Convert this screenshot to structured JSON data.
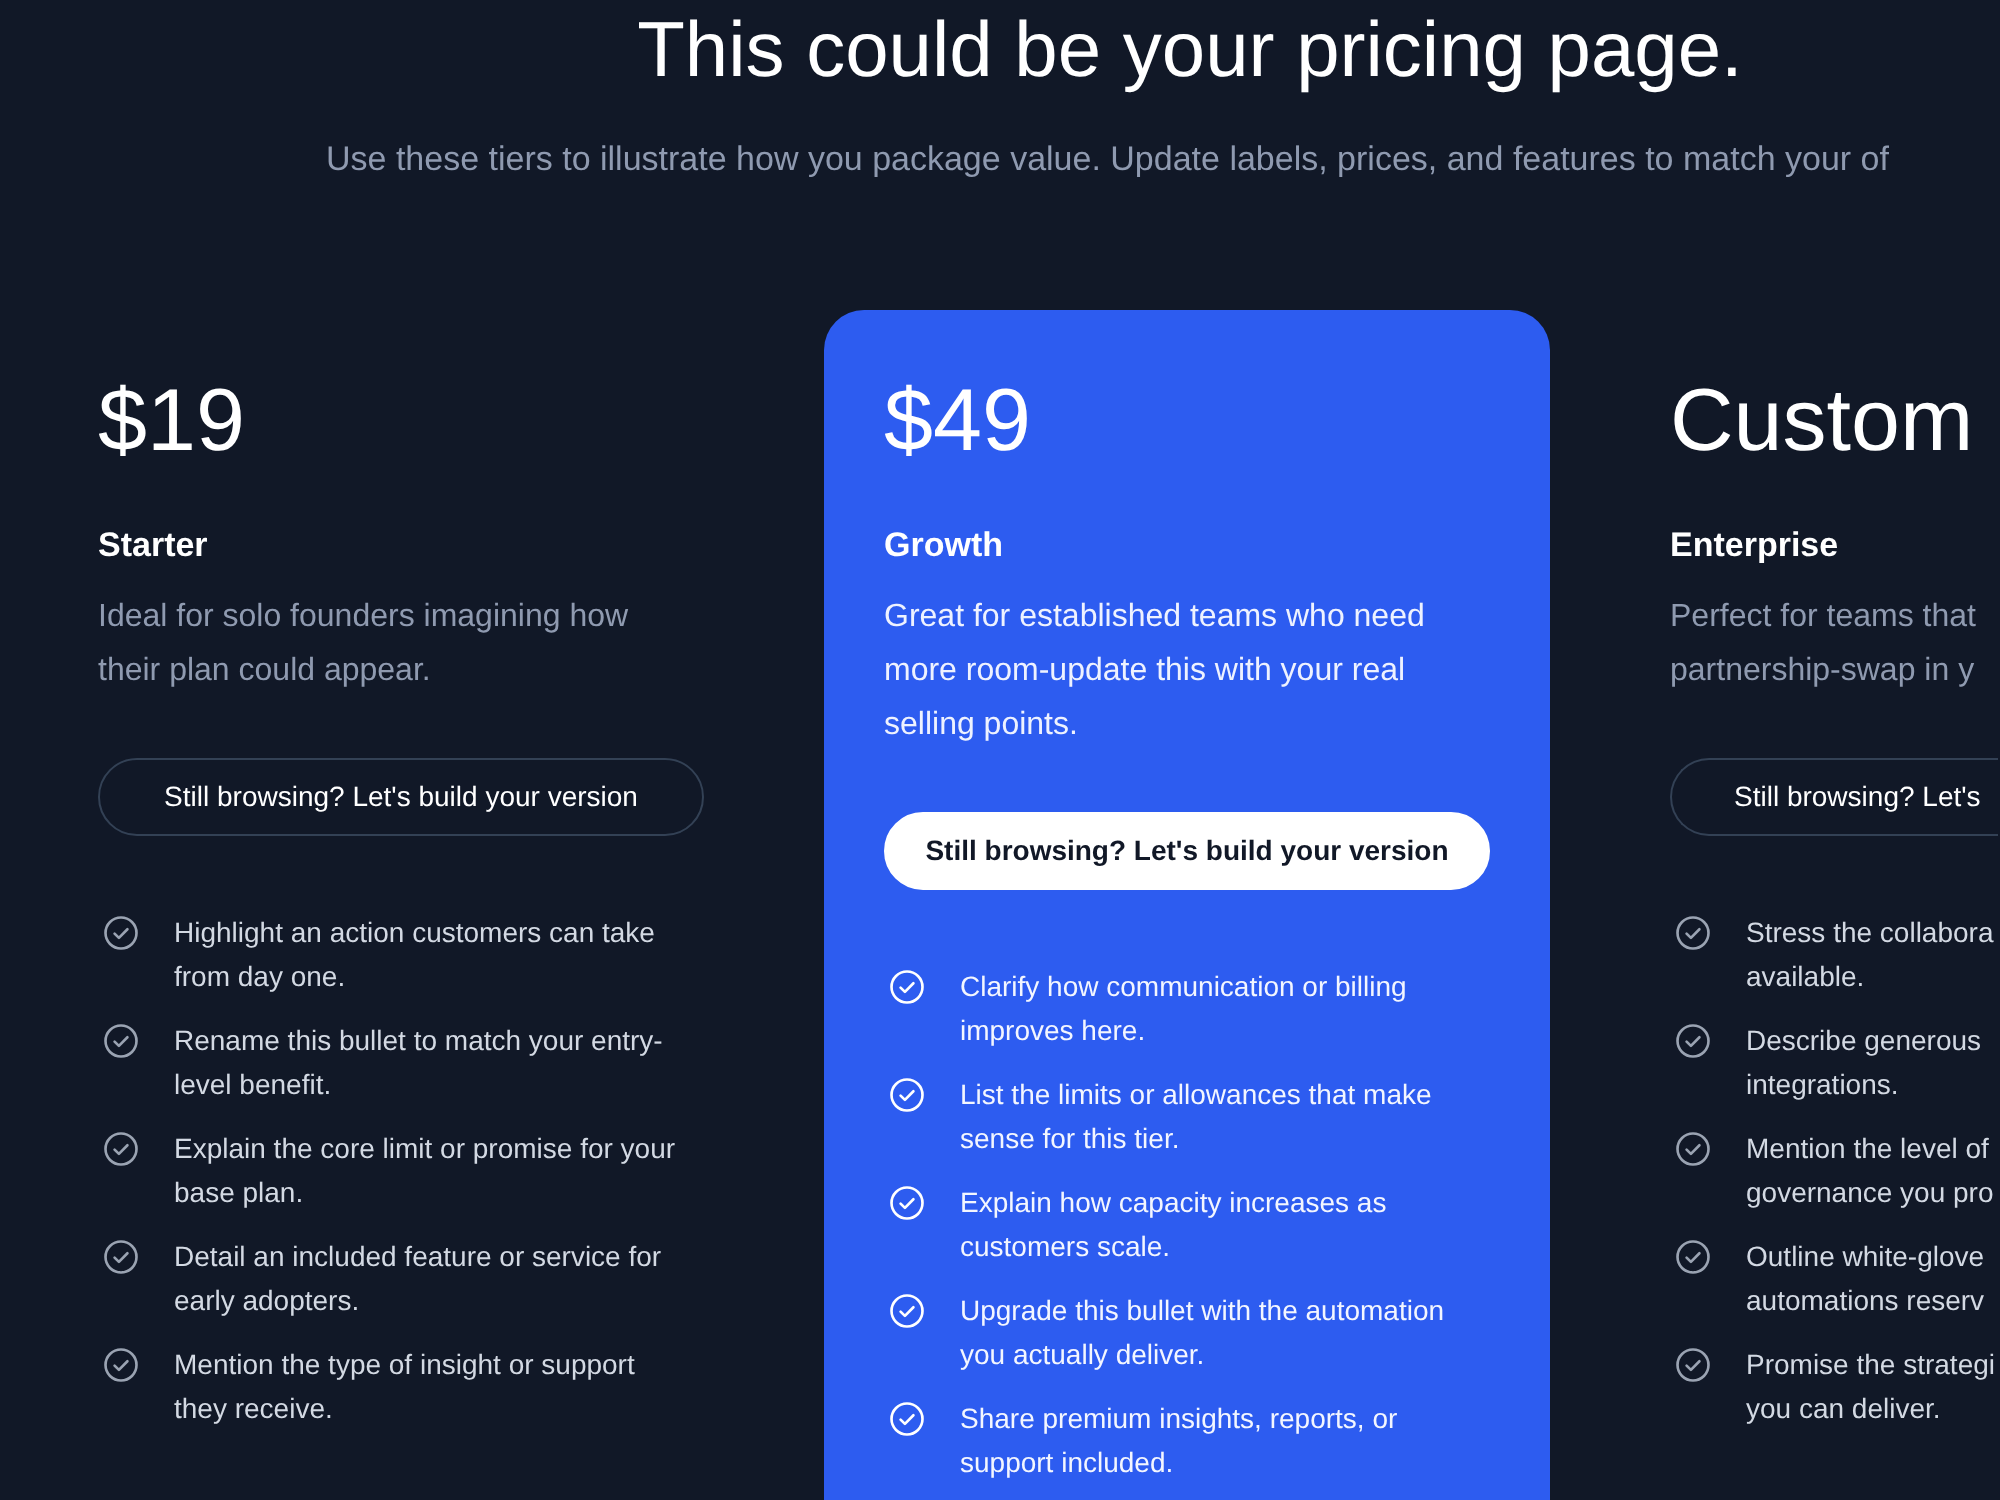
{
  "header": {
    "title": "This could be your pricing page.",
    "subtitle": "Use these tiers to illustrate how you package value. Update labels, prices, and features to match your of"
  },
  "tiers": [
    {
      "price": "$19",
      "name": "Starter",
      "description": "Ideal for solo founders imagining how their plan could appear.",
      "featured": false,
      "button": "Still browsing? Let's build your version",
      "features": [
        "Highlight an action customers can take from day one.",
        "Rename this bullet to match your entry-level benefit.",
        "Explain the core limit or promise for your base plan.",
        "Detail an included feature or service for early adopters.",
        "Mention the type of insight or support they receive."
      ]
    },
    {
      "price": "$49",
      "name": "Growth",
      "description": "Great for established teams who need more room-update this with your real selling points.",
      "featured": true,
      "button": "Still browsing? Let's build your version",
      "features": [
        "Clarify how communication or billing improves here.",
        "List the limits or allowances that make sense for this tier.",
        "Explain how capacity increases as customers scale.",
        "Upgrade this bullet with the automation you actually deliver.",
        "Share premium insights, reports, or support included."
      ]
    },
    {
      "price": "Custom",
      "name": "Enterprise",
      "description": "Perfect for teams that\npartnership-swap in y",
      "featured": false,
      "button": "Still browsing? Let's",
      "features": [
        "Stress the collabora\navailable.",
        "Describe generous\nintegrations.",
        "Mention the level of\ngovernance you pro",
        "Outline white-glove\nautomations reserv",
        "Promise the strategi\nyou can deliver."
      ]
    }
  ]
}
